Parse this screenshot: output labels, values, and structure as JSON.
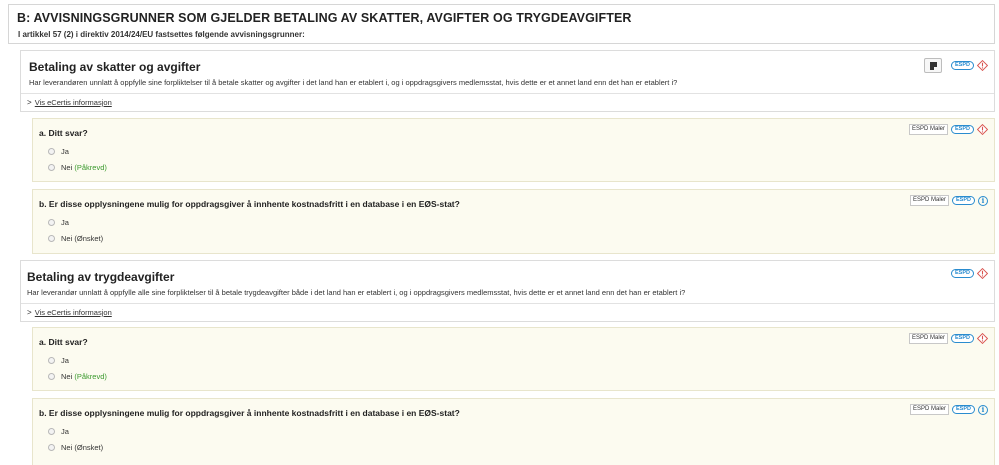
{
  "section": {
    "title": "B: AVVISNINGSGRUNNER SOM GJELDER BETALING AV SKATTER, AVGIFTER OG TRYGDEAVGIFTER",
    "subtitle": "I artikkel 57 (2) i direktiv 2014/24/EU fastsettes følgende avvisningsgrunner:"
  },
  "common": {
    "espd_badge": "ESPD",
    "maler_label": "ESPD Maler",
    "ecertis_arrow": ">",
    "ecertis_link": "Vis eCertis informasjon",
    "info_glyph": "i"
  },
  "blocks": [
    {
      "title": "Betaling av skatter og avgifter",
      "description": "Har leverandøren unnlatt å oppfylle sine forpliktelser til å betale skatter og avgifter i det land han er etablert i, og i oppdragsgivers medlemsstat, hvis dette er et annet land enn det han er etablert i?",
      "questions": [
        {
          "title": "a. Ditt svar?",
          "options": [
            {
              "label": "Ja"
            },
            {
              "label": "Nei",
              "suffix": "(Påkrevd)"
            }
          ]
        },
        {
          "title": "b. Er disse opplysningene mulig for oppdragsgiver å innhente kostnadsfritt i en database i en EØS-stat?",
          "options": [
            {
              "label": "Ja"
            },
            {
              "label": "Nei",
              "suffix": "(Ønsket)"
            }
          ]
        }
      ]
    },
    {
      "title": "Betaling av trygdeavgifter",
      "description": "Har leverandør unnlatt å oppfylle alle sine forpliktelser til å betale trygdeavgifter både i det land han er etablert i, og i oppdragsgivers medlemsstat, hvis dette er et annet land enn det han er etablert i?",
      "questions": [
        {
          "title": "a. Ditt svar?",
          "options": [
            {
              "label": "Ja"
            },
            {
              "label": "Nei",
              "suffix": "(Påkrevd)"
            }
          ]
        },
        {
          "title": "b. Er disse opplysningene mulig for oppdragsgiver å innhente kostnadsfritt i en database i en EØS-stat?",
          "options": [
            {
              "label": "Ja"
            },
            {
              "label": "Nei",
              "suffix": "(Ønsket)"
            }
          ]
        }
      ]
    }
  ],
  "colors": {
    "espd_blue": "#2a8ccf",
    "warning_red": "#d9534f",
    "required_green": "#3b9a2e",
    "question_bg": "#fcfbf0"
  }
}
